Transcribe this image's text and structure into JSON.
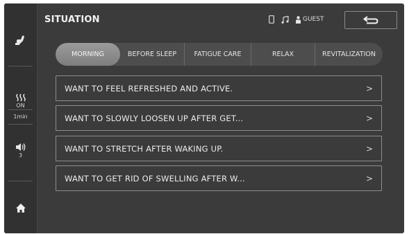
{
  "header": {
    "title": "SITUATION",
    "user_label": "GUEST"
  },
  "sidebar": {
    "heat_status": "ON",
    "heat_timer": "1min",
    "volume_level": "3"
  },
  "tabs": [
    {
      "label": "MORNING",
      "active": true
    },
    {
      "label": "BEFORE SLEEP",
      "active": false
    },
    {
      "label": "FATIGUE CARE",
      "active": false
    },
    {
      "label": "RELAX",
      "active": false
    },
    {
      "label": "REVITALIZATION",
      "active": false
    }
  ],
  "items": [
    {
      "label": "WANT TO FEEL REFRESHED AND ACTIVE.",
      "chevron": ">"
    },
    {
      "label": "WANT TO SLOWLY LOOSEN UP AFTER GET...",
      "chevron": ">"
    },
    {
      "label": "WANT TO STRETCH AFTER WAKING UP.",
      "chevron": ">"
    },
    {
      "label": "WANT TO GET RID OF SWELLING AFTER W...",
      "chevron": ">"
    }
  ]
}
